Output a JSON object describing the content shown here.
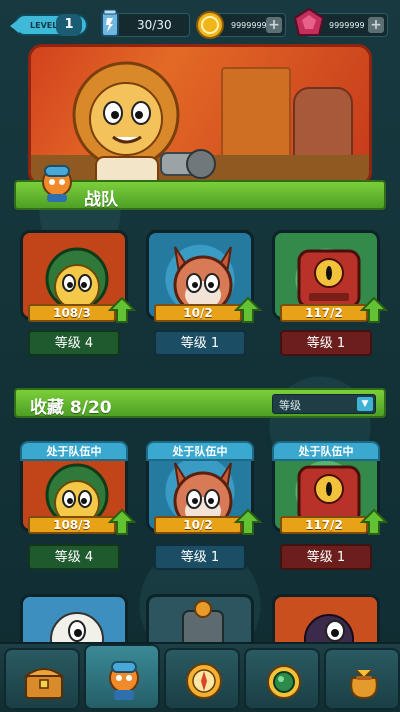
{
  "topbar": {
    "level_label": "LEVEL",
    "level_value": "1",
    "energy": "30/30",
    "coins": "9999999",
    "gems": "9999999"
  },
  "team_section": {
    "title": "战队"
  },
  "team_cards": [
    {
      "progress": "108/3",
      "level": "等级 4",
      "theme": "green"
    },
    {
      "progress": "10/2",
      "level": "等级 1",
      "theme": "blue"
    },
    {
      "progress": "117/2",
      "level": "等级 1",
      "theme": "red"
    }
  ],
  "collection_section": {
    "title": "收藏 8/20",
    "sort_label": "等级"
  },
  "collection_cards": [
    {
      "badge": "处于队伍中",
      "progress": "108/3",
      "level": "等级 4",
      "theme": "green"
    },
    {
      "badge": "处于队伍中",
      "progress": "10/2",
      "level": "等级 1",
      "theme": "blue"
    },
    {
      "badge": "处于队伍中",
      "progress": "117/2",
      "level": "等级 1",
      "theme": "red"
    }
  ],
  "nav": [
    "treasure-chest-icon",
    "team-icon",
    "compass-icon",
    "gem-ring-icon",
    "loot-bag-icon"
  ],
  "colors": {
    "accent_green": "#4da025",
    "accent_blue": "#3fb9d8",
    "progress_gold": "#e7a218"
  }
}
